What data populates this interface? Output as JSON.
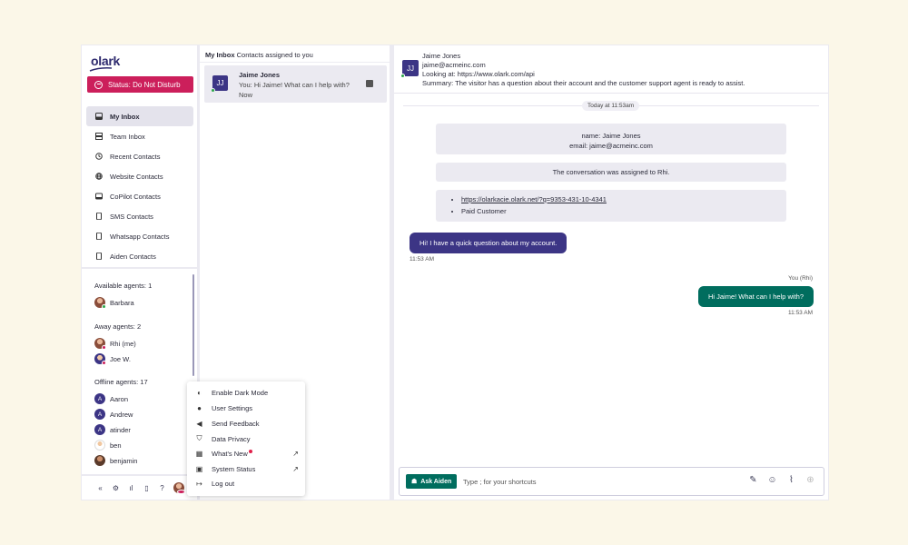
{
  "brand": {
    "logo_text": "olark"
  },
  "status": {
    "label": "Status: Do Not Disturb",
    "color": "#cc1f5b"
  },
  "nav": {
    "items": [
      {
        "label": "My Inbox",
        "icon": "inbox-icon",
        "active": true
      },
      {
        "label": "Team Inbox",
        "icon": "team-inbox-icon"
      },
      {
        "label": "Recent Contacts",
        "icon": "history-icon"
      },
      {
        "label": "Website Contacts",
        "icon": "globe-icon"
      },
      {
        "label": "CoPilot Contacts",
        "icon": "copilot-icon"
      },
      {
        "label": "SMS Contacts",
        "icon": "phone-icon"
      },
      {
        "label": "Whatsapp Contacts",
        "icon": "phone-icon"
      },
      {
        "label": "Aiden Contacts",
        "icon": "phone-icon"
      }
    ]
  },
  "agents": {
    "available_label": "Available agents: 1",
    "available": [
      {
        "name": "Barbara"
      }
    ],
    "away_label": "Away agents: 2",
    "away": [
      {
        "name": "Rhi (me)"
      },
      {
        "name": "Joe W."
      }
    ],
    "offline_label": "Offline agents: 17",
    "offline": [
      {
        "name": "Aaron",
        "initial": "A"
      },
      {
        "name": "Andrew",
        "initial": "A"
      },
      {
        "name": "atinder",
        "initial": "A"
      },
      {
        "name": "ben"
      },
      {
        "name": "benjamin"
      }
    ]
  },
  "inbox": {
    "title_bold": "My Inbox",
    "title_rest": "Contacts assigned to you",
    "conversations": [
      {
        "initials": "JJ",
        "name": "Jaime Jones",
        "snippet": "You: Hi Jaime! What can I help with?",
        "time": "Now"
      }
    ]
  },
  "chat": {
    "initials": "JJ",
    "name": "Jaime Jones",
    "email": "jaime@acmeinc.com",
    "looking_at": "Looking at: https://www.olark.com/api",
    "summary": "Summary: The visitor has a question about their account and the customer support agent is ready to assist.",
    "day_label": "Today at 11:53am",
    "info_name": "name: Jaime Jones",
    "info_email": "email: jaime@acmeinc.com",
    "assigned": "The conversation was assigned to Rhi.",
    "link": "https://olarkacie.olark.net/?q=9353-431-10-4341",
    "tag": "Paid Customer",
    "visitor_msg": "Hi! I have a quick question about my account.",
    "visitor_time": "11:53 AM",
    "agent_label": "You (Rhi)",
    "agent_msg": "Hi Jaime! What can I help with?",
    "agent_time": "11:53 AM"
  },
  "composer": {
    "ask_button": "Ask Aiden",
    "placeholder": "Type ; for your shortcuts"
  },
  "menu": {
    "items": [
      {
        "label": "Enable Dark Mode",
        "icon": "moon-icon"
      },
      {
        "label": "User Settings",
        "icon": "user-icon"
      },
      {
        "label": "Send Feedback",
        "icon": "megaphone-icon"
      },
      {
        "label": "Data Privacy",
        "icon": "shield-icon"
      },
      {
        "label": "What's New",
        "icon": "news-icon",
        "badge": true,
        "external": true
      },
      {
        "label": "System Status",
        "icon": "status-icon",
        "external": true
      },
      {
        "label": "Log out",
        "icon": "logout-icon"
      }
    ]
  },
  "colors": {
    "accent": "#3c3585",
    "agent_bubble": "#006d5e",
    "online": "#2ea84b"
  }
}
